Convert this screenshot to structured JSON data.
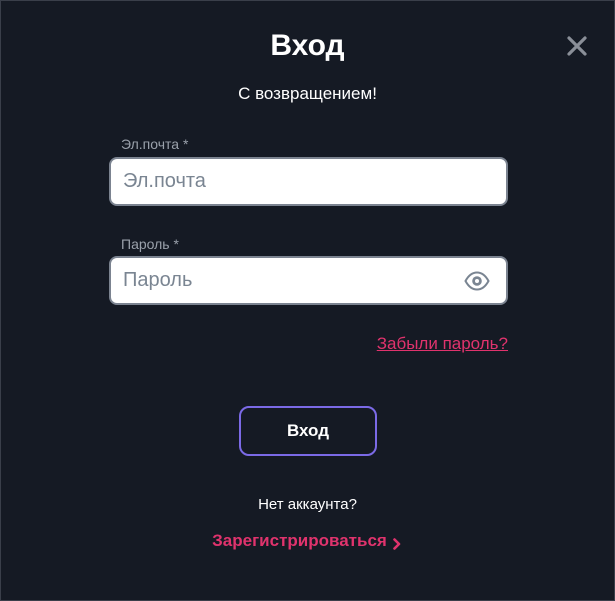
{
  "dialog": {
    "title": "Вход",
    "subtitle": "С возвращением!",
    "close_icon": "close-icon"
  },
  "email": {
    "label": "Эл.почта *",
    "placeholder": "Эл.почта",
    "value": ""
  },
  "password": {
    "label": "Пароль *",
    "placeholder": "Пароль",
    "value": "",
    "toggle_icon": "eye-icon"
  },
  "forgot_password": "Забыли пароль?",
  "login_button": "Вход",
  "signup": {
    "prompt": "Нет аккаунта?",
    "link": "Зарегистрироваться",
    "icon": "chevron-right-icon"
  },
  "colors": {
    "background": "#151a24",
    "accent_pink": "#e0336d",
    "button_border": "#7b6ae6",
    "field_border": "#7b8390",
    "label_gray": "#9aa1ab"
  }
}
